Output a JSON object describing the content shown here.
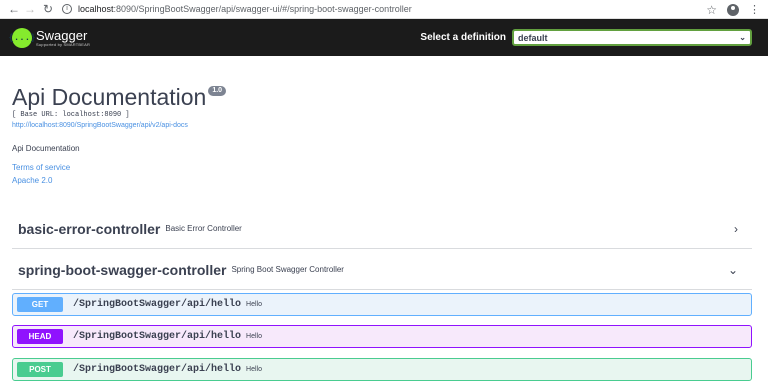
{
  "browser": {
    "url_host": "localhost",
    "url_path": ":8090/SpringBootSwagger/api/swagger-ui/#/spring-boot-swagger-controller"
  },
  "topbar": {
    "logo_name": "Swagger",
    "logo_sub": "Supported by SMARTBEAR",
    "logo_glyph": "{...}",
    "definition_label": "Select a definition",
    "definition_value": "default"
  },
  "info": {
    "title": "Api Documentation",
    "version": "1.0",
    "base_url": "[ Base URL: localhost:8090 ]",
    "docs_link": "http://localhost:8090/SpringBootSwagger/api/v2/api-docs",
    "description": "Api Documentation",
    "terms": "Terms of service",
    "license": "Apache 2.0"
  },
  "tags": [
    {
      "name": "basic-error-controller",
      "description": "Basic Error Controller",
      "expanded": false
    },
    {
      "name": "spring-boot-swagger-controller",
      "description": "Spring Boot Swagger Controller",
      "expanded": true
    }
  ],
  "operations": [
    {
      "method": "GET",
      "path": "/SpringBootSwagger/api/hello",
      "summary": "Hello"
    },
    {
      "method": "HEAD",
      "path": "/SpringBootSwagger/api/hello",
      "summary": "Hello"
    },
    {
      "method": "POST",
      "path": "/SpringBootSwagger/api/hello",
      "summary": "Hello"
    }
  ],
  "colors": {
    "get": "#61affe",
    "head": "#9012fe",
    "post": "#49cc90",
    "topbar": "#1b1b1b",
    "swagger_green": "#85ea2d"
  }
}
